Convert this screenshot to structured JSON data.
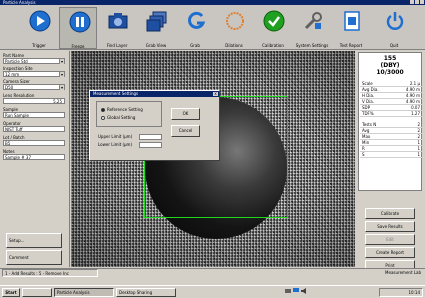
{
  "window": {
    "title": "Particle Analysis"
  },
  "toolbar": {
    "tools": [
      {
        "name": "tool-trigger",
        "label": "Trigger",
        "icon": "play-circle-icon",
        "color": "#1e6fd0"
      },
      {
        "name": "tool-freeze",
        "label": "Freeze",
        "icon": "pause-circle-icon",
        "color": "#1e6fd0"
      },
      {
        "name": "tool-find-layer",
        "label": "Find Layer",
        "icon": "camera-icon",
        "color": "#1e4fa0"
      },
      {
        "name": "tool-grab-view",
        "label": "Grab View",
        "icon": "layers-icon",
        "color": "#1e4fa0"
      },
      {
        "name": "tool-grab",
        "label": "Grab",
        "icon": "g-letter-icon",
        "color": "#1e6fd0"
      },
      {
        "name": "tool-dilations",
        "label": "Dilations",
        "icon": "ring-icon",
        "color": "#e08030"
      },
      {
        "name": "tool-calibration",
        "label": "Calibration",
        "icon": "check-circle-icon",
        "color": "#20a020"
      },
      {
        "name": "tool-system-settings",
        "label": "System Settings",
        "icon": "wrench-icon",
        "color": "#606060"
      },
      {
        "name": "tool-test-report",
        "label": "Test Report",
        "icon": "report-icon",
        "color": "#1e6fd0"
      },
      {
        "name": "tool-quit",
        "label": "Quit",
        "icon": "power-icon",
        "color": "#1e6fd0"
      }
    ]
  },
  "left": {
    "fields": [
      {
        "label": "Part Name",
        "value": "Particle Std",
        "dropdown": true
      },
      {
        "label": "Inspection Site",
        "value": "12 mm",
        "dropdown": true
      },
      {
        "label": "Camera Sizer",
        "value": "D50",
        "dropdown": true
      },
      {
        "label": "Lens Resolution",
        "value": "5.25",
        "dropdown": false
      },
      {
        "label": "Sample",
        "value": "Run Sample",
        "dropdown": false
      },
      {
        "label": "Operator",
        "value": "NIST Tuff",
        "dropdown": false
      },
      {
        "label": "Lot / Batch",
        "value": "B5",
        "dropdown": false
      },
      {
        "label": "Notes",
        "value": "Sample # 37",
        "dropdown": false
      }
    ],
    "btn_setup": "Setup...",
    "btn_comment": "Comment"
  },
  "dialog": {
    "title": "Measurement Settings",
    "close_glyph": "x",
    "radio1": "Reference Setting",
    "radio2": "Global Setting",
    "ok": "OK",
    "cancel": "Cancel",
    "row1": "Upper Limit (µm)",
    "row2": "Lower Limit (µm)"
  },
  "right": {
    "head1": "155",
    "head2": "(DBY)",
    "head3": "10/3000",
    "stats": [
      {
        "k": "Scale",
        "v": "2.1 µ"
      },
      {
        "k": "Avg Dia.",
        "v": "4.90 m"
      },
      {
        "k": "H Dia.",
        "v": "4.90 m"
      },
      {
        "k": "V Dia.",
        "v": "4.90 m"
      },
      {
        "k": "SDP",
        "v": "0.07"
      },
      {
        "k": "TDF%",
        "v": "1.27"
      },
      {
        "k": "",
        "v": ""
      },
      {
        "k": "Tests N",
        "v": "2"
      },
      {
        "k": "Avg",
        "v": "2"
      },
      {
        "k": "Max",
        "v": "2"
      },
      {
        "k": "Min",
        "v": "1"
      },
      {
        "k": "R",
        "v": "1"
      },
      {
        "k": "S",
        "v": "1"
      }
    ],
    "buttons": [
      {
        "label": "Calibrate",
        "disabled": false
      },
      {
        "label": "Save Results",
        "disabled": false
      },
      {
        "label": "Edit",
        "disabled": true
      },
      {
        "label": "Create Report",
        "disabled": false
      },
      {
        "label": "Print",
        "disabled": false
      }
    ]
  },
  "status": {
    "left": "1 - Add Results : 5 - Remove Inc",
    "right": "Measurement Lab"
  },
  "taskbar": {
    "start": "Start",
    "tasks": [
      "Particle Analysis",
      "Desktop Sharing"
    ],
    "clock": "10:14"
  }
}
